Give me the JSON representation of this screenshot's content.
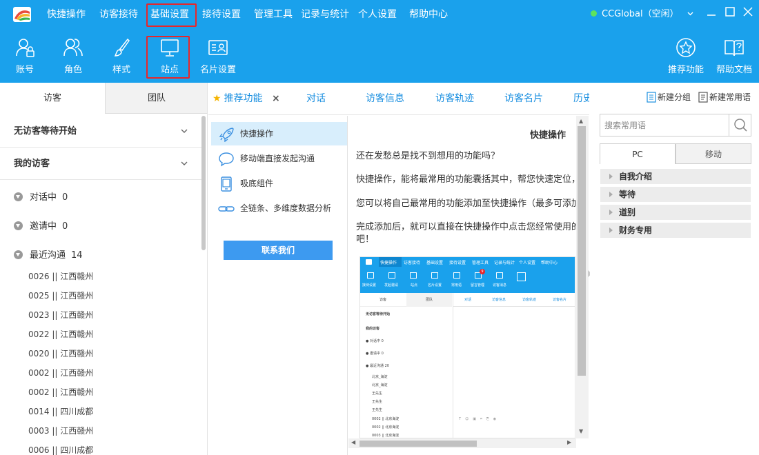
{
  "menu": {
    "items": [
      "快捷操作",
      "访客接待",
      "基础设置",
      "接待设置",
      "管理工具",
      "记录与统计",
      "个人设置",
      "帮助中心"
    ],
    "highlighted": "基础设置",
    "status": "CCGlobal（空闲）",
    "status_color": "#5ee35e",
    "bar_color": "#1aa1ec",
    "highlight_color": "#e8262a"
  },
  "toolbar": {
    "left": [
      "账号",
      "角色",
      "样式",
      "站点",
      "名片设置"
    ],
    "right": [
      "推荐功能",
      "帮助文档"
    ],
    "highlighted": "站点"
  },
  "left": {
    "tabs": [
      "访客",
      "团队"
    ],
    "sections": [
      "无访客等待开始",
      "我的访客"
    ],
    "groups": [
      {
        "label": "对话中",
        "count": "0"
      },
      {
        "label": "邀请中",
        "count": "0"
      },
      {
        "label": "最近沟通",
        "count": "14"
      }
    ],
    "visitors": [
      "0026 || 江西赣州",
      "0025 || 江西赣州",
      "0023 || 江西赣州",
      "0022 || 江西赣州",
      "0020 || 江西赣州",
      "0002 || 江西赣州",
      "0002 || 江西赣州",
      "0014 || 四川成都",
      "0003 || 江西赣州",
      "0006 || 四川成都"
    ]
  },
  "center": {
    "tabs": [
      "推荐功能",
      "对话",
      "访客信息",
      "访客轨迹",
      "访客名片",
      "历史"
    ],
    "close_icon": "×",
    "features": [
      "快捷操作",
      "移动端直接发起沟通",
      "吸底组件",
      "全链条、多维度数据分析"
    ],
    "contact_button": "联系我们",
    "detail": {
      "title": "快捷操作",
      "p1": "还在发愁总是找不到想用的功能吗？",
      "p2": "快捷操作，能将最常用的功能囊括其中，帮您快速定位，",
      "p3": "您可以将自己最常用的功能添加至快捷操作（最多可添加",
      "p4a": "完成添加后，就可以直接在快捷操作中点击您经常使用的",
      "p4b": "吧！"
    },
    "preview": {
      "menu": [
        "快捷操作",
        "访客接待",
        "基础设置",
        "接待设置",
        "管理工具",
        "记录与统计",
        "个人设置",
        "帮助中心"
      ],
      "tools": [
        "接待设置",
        "发起邀请",
        "站点",
        "名片设置",
        "常用语",
        "留言管理",
        "访客消息"
      ],
      "badge": "9",
      "tabs": [
        "访客",
        "团队"
      ],
      "ctabs": [
        "对话",
        "访客信息",
        "访客轨迹",
        "访客名片"
      ],
      "sections": [
        "无访客等待开始",
        "我的访客"
      ],
      "groups": [
        {
          "label": "对话中",
          "count": "0"
        },
        {
          "label": "邀请中",
          "count": "0"
        },
        {
          "label": "最近沟通",
          "count": "20"
        }
      ],
      "rows": [
        "北京_海淀",
        "北京_海淀",
        "王先生",
        "王先生",
        "王先生",
        "0002 || 北京海淀",
        "0002 || 北京海淀",
        "0003 || 北京海淀"
      ]
    }
  },
  "right": {
    "new_group": "新建分组",
    "new_phrase": "新建常用语",
    "search_placeholder": "搜索常用语",
    "tabs": [
      "PC",
      "移动"
    ],
    "categories": [
      "自我介绍",
      "等待",
      "道别",
      "财务专用"
    ]
  }
}
